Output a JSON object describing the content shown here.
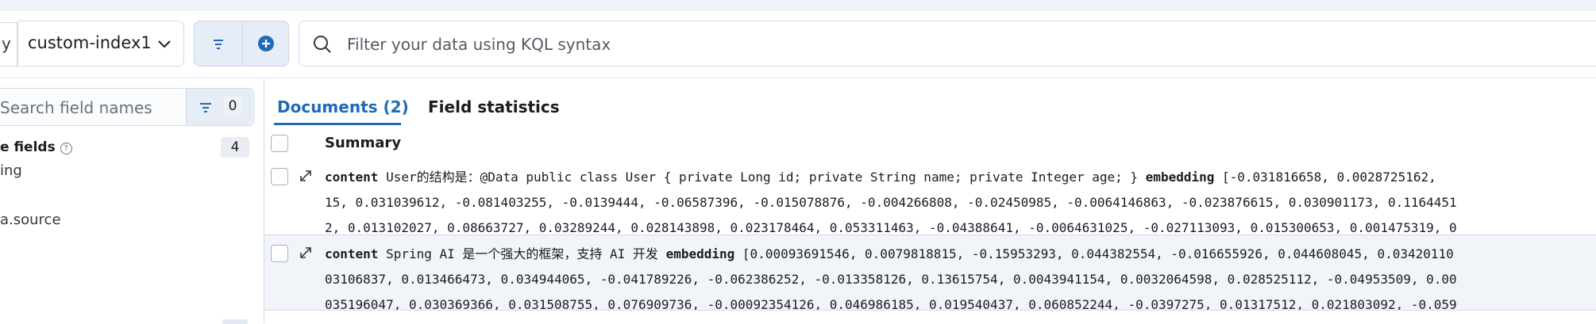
{
  "query_bar": {
    "data_view_prefix": "y",
    "data_view": "custom-index1",
    "search_placeholder": "Filter your data using KQL syntax"
  },
  "sidebar": {
    "search_placeholder": "Search field names",
    "filter_count": "0",
    "section_title": "e fields",
    "section_count": "4",
    "fields": [
      "ing",
      "a.source"
    ]
  },
  "tabs": {
    "documents": "Documents (2)",
    "field_statistics": "Field statistics"
  },
  "grid": {
    "summary_header": "Summary",
    "rows": [
      {
        "line1_key1": "content",
        "line1_val1": " User的结构是：@Data public class User { private Long id; private String name; private Integer age; }  ",
        "line1_key2": "embedding",
        "line1_val2": " [-0.031816658, 0.0028725162, ",
        "line2": "15, 0.031039612, -0.081403255, -0.0139444, -0.06587396, -0.015078876, -0.004266808, -0.02450985, -0.0064146863, -0.023876615, 0.030901173, 0.1164451",
        "line3": "2, 0.013102027, 0.08663727, 0.03289244, 0.028143898, 0.023178464, 0.053311463, -0.04388641, -0.0064631025, -0.027113093, 0.015300653, 0.001475319, 0"
      },
      {
        "line1_key1": "content",
        "line1_val1": " Spring AI 是一个强大的框架，支持 AI 开发 ",
        "line1_key2": "embedding",
        "line1_val2": " [0.00093691546, 0.0079818815, -0.15953293, 0.044382554, -0.016655926, 0.044608045, 0.03420110",
        "line2": "03106837, 0.013466473, 0.034944065, -0.041789226, -0.062386252, -0.013358126, 0.13615754, 0.0043941154, 0.0032064598, 0.028525112, -0.04953509, 0.00",
        "line3": "035196047, 0.030369366, 0.031508755, 0.076909736, -0.00092354126, 0.046986185, 0.019540437, 0.060852244, -0.0397275, 0.01317512, 0.021803092, -0.059"
      }
    ]
  },
  "colors": {
    "accent": "#1f6bb6",
    "border": "#d3dae6",
    "row_alt_bg": "#f1f4f9"
  }
}
